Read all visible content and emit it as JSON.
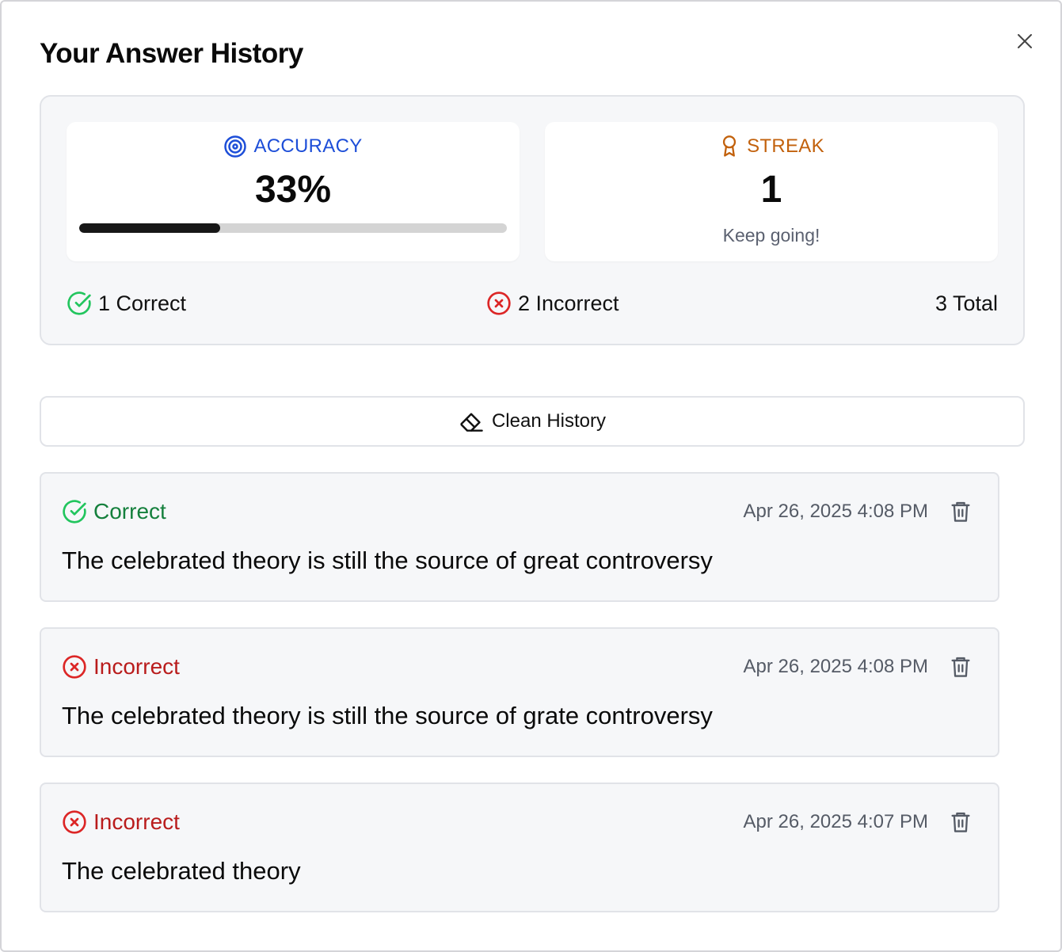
{
  "dialog": {
    "title": "Your Answer History",
    "close_icon": "close-icon"
  },
  "stats": {
    "accuracy": {
      "label": "ACCURACY",
      "value": "33%",
      "progress_fraction": 0.33,
      "icon": "target-icon",
      "color": "#1d4ed8"
    },
    "streak": {
      "label": "STREAK",
      "value": "1",
      "subtext": "Keep going!",
      "icon": "award-icon",
      "color": "#c2610c"
    },
    "summary": {
      "correct": "1 Correct",
      "incorrect": "2 Incorrect",
      "total": "3 Total"
    }
  },
  "clean_history": {
    "label": "Clean History",
    "icon": "eraser-icon"
  },
  "entries": [
    {
      "status": "Correct",
      "timestamp": "Apr 26, 2025 4:08 PM",
      "text": "The celebrated theory is still the source of great controversy"
    },
    {
      "status": "Incorrect",
      "timestamp": "Apr 26, 2025 4:08 PM",
      "text": "The celebrated theory is still the source of grate controversy"
    },
    {
      "status": "Incorrect",
      "timestamp": "Apr 26, 2025 4:07 PM",
      "text": "The celebrated theory"
    }
  ],
  "colors": {
    "correct": "#22c55e",
    "correct_text": "#15803d",
    "incorrect": "#dc2626",
    "incorrect_text": "#b91c1c"
  }
}
